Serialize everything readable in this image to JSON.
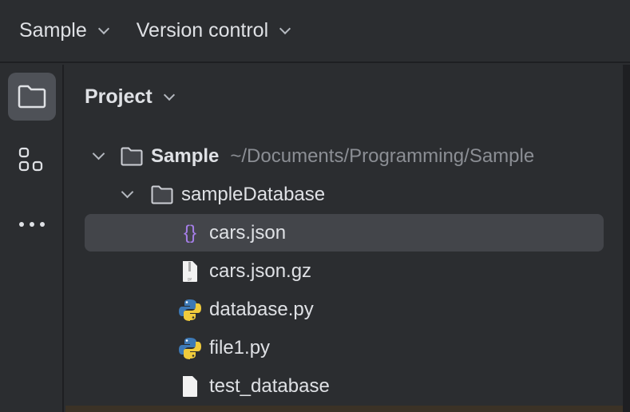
{
  "header": {
    "project_menu": "Sample",
    "vcs_menu": "Version control"
  },
  "panel": {
    "title": "Project"
  },
  "tree": {
    "root": {
      "label": "Sample",
      "path": "~/Documents/Programming/Sample"
    },
    "folder": {
      "label": "sampleDatabase"
    },
    "files": [
      {
        "label": "cars.json",
        "icon": "json-icon"
      },
      {
        "label": "cars.json.gz",
        "icon": "archive-file-icon"
      },
      {
        "label": "database.py",
        "icon": "python-icon"
      },
      {
        "label": "file1.py",
        "icon": "python-icon"
      },
      {
        "label": "test_database",
        "icon": "file-icon"
      }
    ]
  },
  "colors": {
    "json_icon": "#a57ee8",
    "py_blue": "#3d79b6",
    "py_yellow": "#f0cb3c"
  }
}
